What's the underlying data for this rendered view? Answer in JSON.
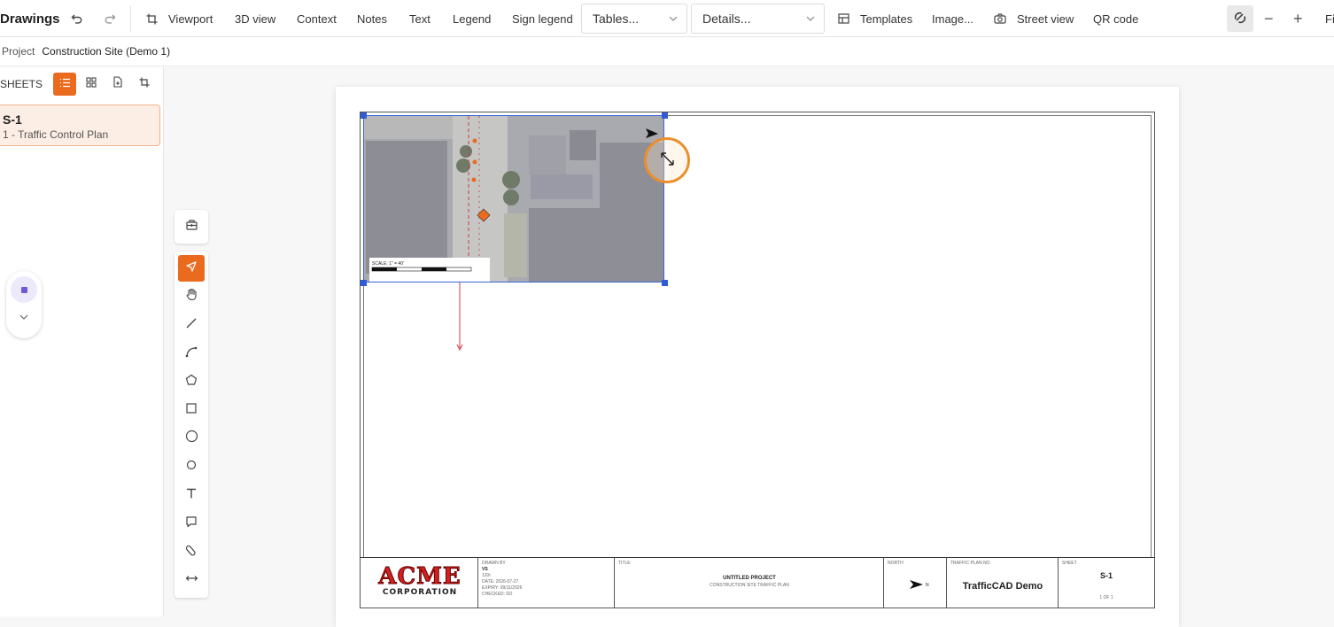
{
  "topbar": {
    "title": "Drawings",
    "viewport_label": "Viewport",
    "view3d_label": "3D view",
    "context_label": "Context",
    "notes_label": "Notes",
    "text_label": "Text",
    "legend_label": "Legend",
    "sign_legend_label": "Sign legend",
    "tables_select": "Tables...",
    "details_select": "Details...",
    "templates_label": "Templates",
    "image_label": "Image...",
    "street_view_label": "Street view",
    "qr_code_label": "QR code",
    "zoom_out_symbol": "−",
    "zoom_in_symbol": "+",
    "fit_label": "Fi"
  },
  "breadcrumb": {
    "label": "Project",
    "value": "Construction Site (Demo 1)"
  },
  "sidebar": {
    "header": "SHEETS",
    "sheets": [
      {
        "id": "S-1",
        "subtitle": "1 - Traffic Control Plan"
      }
    ]
  },
  "drawing": {
    "scale_text": "SCALE: 1\" = 40'",
    "titleblock": {
      "logo_top": "ACME",
      "logo_bottom": "CORPORATION",
      "drawn_by_label": "DRAWN BY",
      "drawn_by_value": "VS",
      "rev_line": "120r",
      "date_line": "DATE: 2026-07-27",
      "expiry_line": "EXPIRY: 09/11/2026",
      "checked_line": "CHECKED: SO",
      "title_label": "TITLE",
      "project_title": "UNTITLED PROJECT",
      "project_subtitle": "CONSTRUCTION SITE TRAFFIC PLAN",
      "north_label": "NORTH",
      "north_letter": "N",
      "traffic_label": "TRAFFIC PLAN NO.",
      "company": "TrafficCAD Demo",
      "sheet_label": "SHEET",
      "sheet_value": "S-1",
      "sheet_of": "1 OF 1"
    }
  },
  "colors": {
    "accent": "#ea6a1e",
    "selection": "#2f5bd6",
    "highlight_ring": "#ea8f2c"
  }
}
